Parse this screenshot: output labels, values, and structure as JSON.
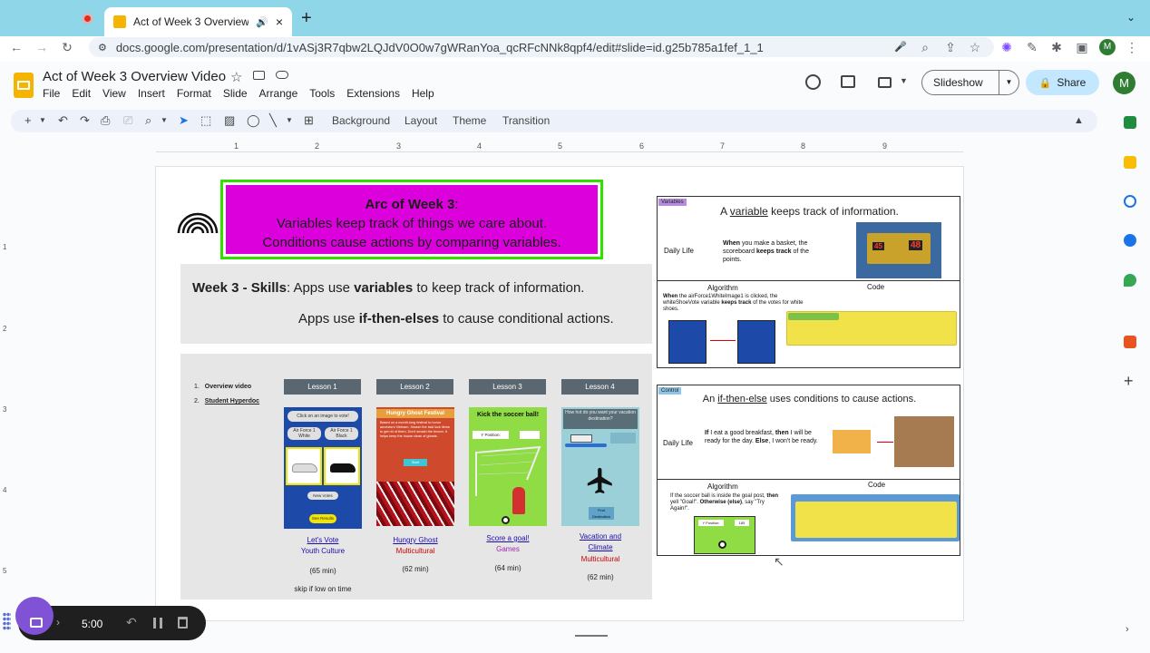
{
  "browser": {
    "tab_title": "Act of Week 3 Overview Vi",
    "url": "docs.google.com/presentation/d/1vASj3R7qbw2LQJdV0O0w7gWRanYoa_qcRFcNNk8qpf4/edit#slide=id.g25b785a1fef_1_1",
    "profile_initial": "M"
  },
  "doc": {
    "title": "Act of Week 3 Overview Video",
    "menus": [
      "File",
      "Edit",
      "View",
      "Insert",
      "Format",
      "Slide",
      "Arrange",
      "Tools",
      "Extensions",
      "Help"
    ],
    "slideshow_label": "Slideshow",
    "share_label": "Share",
    "avatar_initial": "M"
  },
  "toolbar": {
    "background": "Background",
    "layout": "Layout",
    "theme": "Theme",
    "transition": "Transition"
  },
  "ruler": {
    "h_ticks": [
      "1",
      "2",
      "3",
      "4",
      "5",
      "6",
      "7",
      "8",
      "9"
    ],
    "v_ticks": [
      "1",
      "2",
      "3",
      "4",
      "5"
    ]
  },
  "slide": {
    "header": {
      "title": "Arc of Week 3",
      "line1": "Variables keep track of things we care about.",
      "line2": "Conditions cause actions by comparing variables."
    },
    "skills": {
      "label": "Week 3 - Skills",
      "l1_pre": ": Apps use ",
      "l1_bold": "variables",
      "l1_post": " to keep track of information.",
      "l2_pre": "Apps use ",
      "l2_bold": "if-then-elses",
      "l2_post": " to cause conditional actions."
    },
    "links": {
      "item1_num": "1.",
      "item1": "Overview video",
      "item2_num": "2.",
      "item2": "Student Hyperdoc"
    },
    "lessons": [
      {
        "head": "Lesson 1",
        "name": "Let's Vote",
        "cat": "Youth Culture",
        "cat_color": "#1a0dab",
        "min": "(65 min)",
        "note": "skip if low on time"
      },
      {
        "head": "Lesson 2",
        "name": "Hungry Ghost",
        "cat": "Multicultural",
        "cat_color": "#cc0000",
        "min": "(62 min)"
      },
      {
        "head": "Lesson 3",
        "name": "Score a goal!",
        "cat": "Games",
        "cat_color": "#9c27b0",
        "min": "(64 min)"
      },
      {
        "head": "Lesson 4",
        "name": "Vacation and",
        "name2": "Climate",
        "cat": "Multicultural",
        "cat_color": "#cc0000",
        "min": "(62 min)"
      }
    ],
    "thumbs": {
      "t1_top": "Click on an image to vote!",
      "t1_a": "Air Force 1 White",
      "t1_b": "Air Force 1 Black",
      "t1_btn1": "New Votes",
      "t1_btn2": "See Results",
      "t2_title": "Hungry Ghost Festival",
      "t2_text": "Based on a month-long festival to honor ancestors Vietnam. Smash the bad luck items to get rid of them. Don't smash the broom. It helps keep the house clean of ghosts.",
      "t2_btn": "Start",
      "t3_title": "Kick the soccer ball!",
      "t3_label": "Y Position:",
      "t4_title": "How hot do you want your vacation destination?",
      "t4_btn": "Find Destination"
    },
    "variables_panel": {
      "tag": "Variables",
      "title_pre": "A ",
      "title_u": "variable",
      "title_post": " keeps track of information.",
      "daily_life": "Daily Life",
      "d_b1": "When",
      "d_t1": " you make a basket, the scoreboard ",
      "d_b2": "keeps track",
      "d_t2": " of the points.",
      "score_home": "48",
      "score_guest": "45",
      "algorithm": "Algorithm",
      "code": "Code",
      "a_b1": "When",
      "a_t1": " the airForce1WhiteImage1 is clicked, the whiteShoeVote variable ",
      "a_b2": "keeps track",
      "a_t2": " of the votes for white shoes."
    },
    "control_panel": {
      "tag": "Control",
      "title_pre": "An ",
      "title_u": "if-then-else",
      "title_post": " uses conditions to cause actions.",
      "daily_life": "Daily Life",
      "d_b1": "If",
      "d_t1": " I eat a good breakfast, ",
      "d_b2": "then",
      "d_t2": " I will be ready for the day. ",
      "d_b3": "Else",
      "d_t3": ", I won't be ready.",
      "algorithm": "Algorithm",
      "code": "Code",
      "a_t1": "If the soccer ball is inside the goal post, ",
      "a_b1": "then",
      "a_t2": " yell \"Goal!\". ",
      "a_b2": "Otherwise (else)",
      "a_t3": ", say \"Try Again!\".",
      "y_label": "Y Position:",
      "y_value": "185"
    }
  },
  "recorder": {
    "timer": "5:00"
  },
  "colors": {
    "header_fill": "#dc00dc",
    "header_border": "#32e000",
    "tab_strip": "#8fd6e8",
    "share_bg": "#c2e7ff"
  }
}
